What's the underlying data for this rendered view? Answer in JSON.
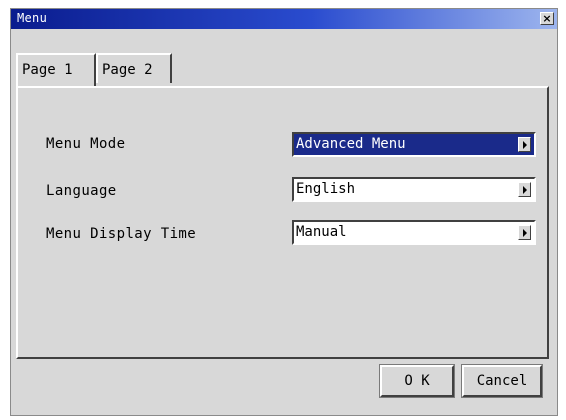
{
  "window": {
    "title": "Menu",
    "close_label": "×"
  },
  "tabs": [
    {
      "label": "Page 1",
      "active": true
    },
    {
      "label": "Page 2",
      "active": false
    }
  ],
  "settings": [
    {
      "label": "Menu Mode",
      "value": "Advanced Menu",
      "selected": true
    },
    {
      "label": "Language",
      "value": "English",
      "selected": false
    },
    {
      "label": "Menu Display Time",
      "value": "Manual",
      "selected": false
    }
  ],
  "buttons": {
    "ok": "O K",
    "cancel": "Cancel"
  },
  "colors": {
    "titlebar_start": "#0a1c8e",
    "titlebar_end": "#9db5ee",
    "selection": "#1a2a8a",
    "face": "#d8d8d8"
  }
}
